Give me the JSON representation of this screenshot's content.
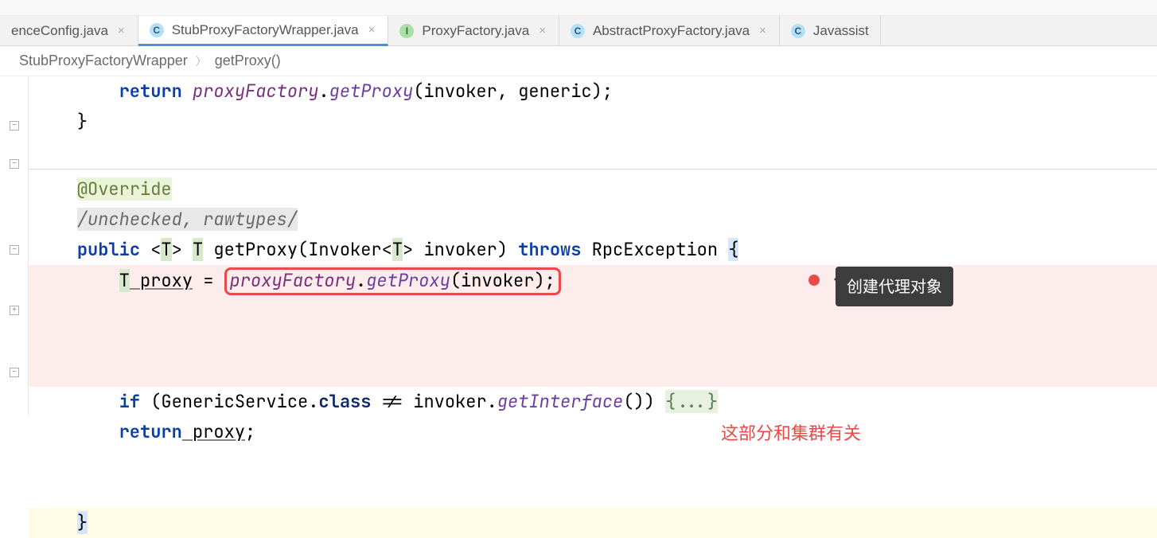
{
  "tabs": [
    {
      "label": "enceConfig.java",
      "icon_kind": "",
      "icon_letter": "",
      "active": false
    },
    {
      "label": "StubProxyFactoryWrapper.java",
      "icon_kind": "class-c",
      "icon_letter": "C",
      "active": true
    },
    {
      "label": "ProxyFactory.java",
      "icon_kind": "iface-i",
      "icon_letter": "I",
      "active": false
    },
    {
      "label": "AbstractProxyFactory.java",
      "icon_kind": "class-c",
      "icon_letter": "C",
      "active": false
    },
    {
      "label": "Javassist",
      "icon_kind": "class-c",
      "icon_letter": "C",
      "active": false,
      "no_close": true
    }
  ],
  "breadcrumb": {
    "class": "StubProxyFactoryWrapper",
    "method": "getProxy()"
  },
  "code": {
    "l1": {
      "return": "return",
      "field": "proxyFactory",
      "dot": ".",
      "call": "getProxy",
      "args": "(invoker, generic);"
    },
    "l2": {
      "brace": "}"
    },
    "l3": {
      "anno": "@Override"
    },
    "l4": {
      "supp": "/unchecked, rawtypes/"
    },
    "l5": {
      "public": "public",
      "gen1": "<",
      "T1": "T",
      "gen2": "> ",
      "T2": "T",
      "method": " getProxy(Invoker<",
      "T3": "T",
      "after": "> invoker) ",
      "throws": "throws",
      "exc": " RpcException ",
      "brace": "{"
    },
    "l6": {
      "indent": "        ",
      "T": "T",
      "var": " proxy",
      "eq": " = ",
      "boxed": "proxyFactory.getProxy(invoker);",
      "box_field": "proxyFactory",
      "box_dot": ".",
      "box_call": "getProxy",
      "box_args": "(invoker);"
    },
    "l7": {
      "indent": "        ",
      "if": "if",
      "open": " (GenericService.",
      "class": "class",
      "rest1": " != invoker.",
      "call": "getInterface",
      "rest2": "()) ",
      "fold": "{...}"
    },
    "l8": {
      "indent": "        ",
      "return": "return",
      "var": " proxy",
      "semi": ";"
    },
    "l9": {
      "brace": "}"
    }
  },
  "annotations": {
    "tooltip": "创建代理对象",
    "note": "这部分和集群有关"
  },
  "gutter": {
    "collapse": "−",
    "expand": "+"
  }
}
